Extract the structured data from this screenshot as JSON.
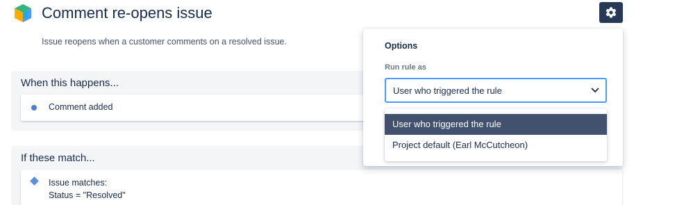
{
  "rule": {
    "title": "Comment re-opens issue",
    "description": "Issue reopens when a customer comments on a resolved issue.",
    "icon": "cube-icon"
  },
  "toolbar": {
    "settings_icon": "gear-icon"
  },
  "trigger_section": {
    "heading": "When this happens...",
    "component": "Comment added"
  },
  "condition_section": {
    "heading": "If these match...",
    "component_line1": "Issue matches:",
    "component_line2": "Status = \"Resolved\""
  },
  "options": {
    "title": "Options",
    "run_rule_label": "Run rule as",
    "selected_value": "User who triggered the rule",
    "menu_items": [
      "User who triggered the rule",
      "Project default (Earl McCutcheon)"
    ]
  },
  "colors": {
    "accent": "#4c9aff",
    "dark_button": "#253858",
    "selected_option": "#42526e"
  }
}
